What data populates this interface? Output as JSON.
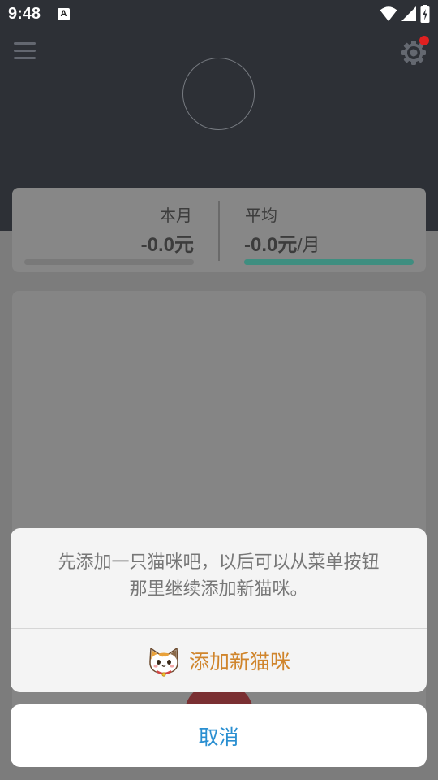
{
  "status_bar": {
    "time": "9:48",
    "notification_icon": "A"
  },
  "header": {
    "menu_icon": "hamburger-menu-icon",
    "settings_icon": "gear-icon",
    "notification_dot_color": "#e02020"
  },
  "summary": {
    "this_month": {
      "label": "本月",
      "value": "-0.0元",
      "progress": 0
    },
    "average": {
      "label": "平均",
      "value": "-0.0元",
      "unit": "/月",
      "progress": 1,
      "bar_color": "#3f8e80"
    }
  },
  "dialog": {
    "message_line1": "先添加一只猫咪吧，以后可以从菜单按钮",
    "message_line2": "那里继续添加新猫咪。",
    "add_button_label": "添加新猫咪",
    "add_button_icon": "cat-face-icon",
    "cancel_label": "取消",
    "accent_color": "#d0852c",
    "cancel_color": "#2a8fd1"
  }
}
